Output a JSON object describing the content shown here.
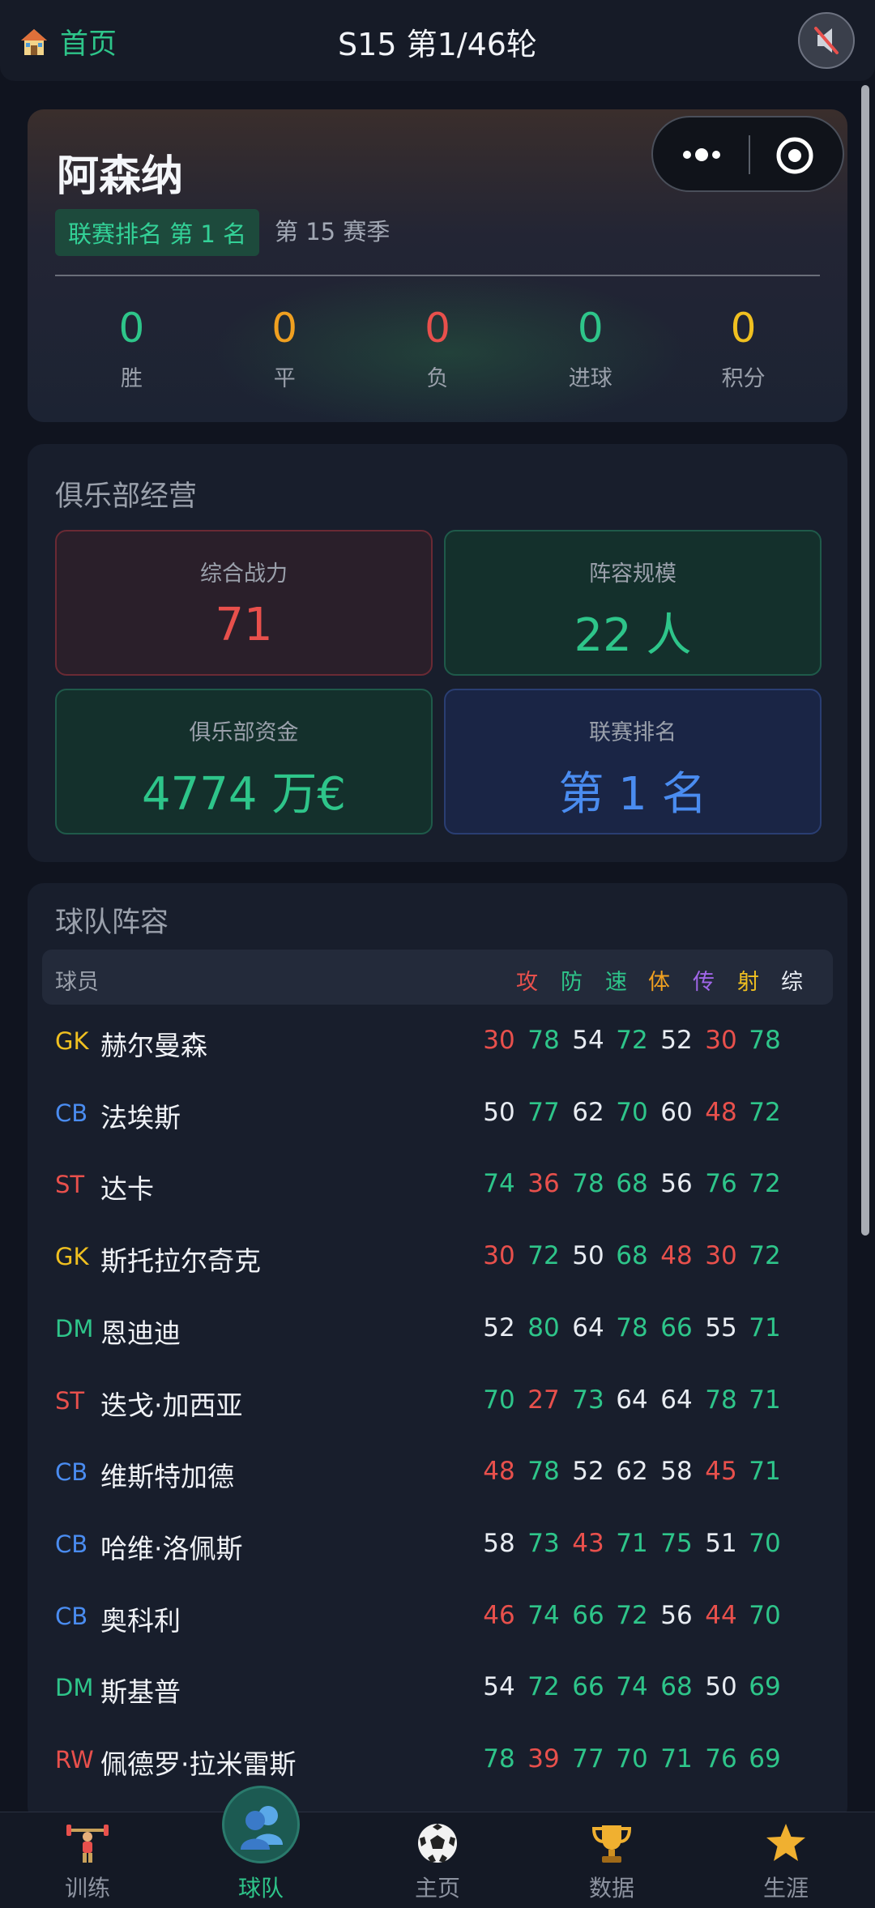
{
  "header": {
    "home_label": "首页",
    "title": "S15 第1/46轮"
  },
  "hero": {
    "team_name": "阿森纳",
    "rank_badge": "联赛排名 第 1 名",
    "season": "第 15 赛季",
    "stats": [
      {
        "label": "胜",
        "value": "0",
        "color": "#2ec58a"
      },
      {
        "label": "平",
        "value": "0",
        "color": "#f0a020"
      },
      {
        "label": "负",
        "value": "0",
        "color": "#e8504c"
      },
      {
        "label": "进球",
        "value": "0",
        "color": "#2ec58a"
      },
      {
        "label": "积分",
        "value": "0",
        "color": "#f0c020"
      }
    ]
  },
  "club": {
    "title": "俱乐部经营",
    "tiles": [
      {
        "label": "综合战力",
        "value": "71"
      },
      {
        "label": "阵容规模",
        "value": "22 人"
      },
      {
        "label": "俱乐部资金",
        "value": "4774 万€"
      },
      {
        "label": "联赛排名",
        "value": "第 1 名"
      }
    ]
  },
  "roster": {
    "title": "球队阵容",
    "headers": {
      "player": "球员",
      "cols": [
        "攻",
        "防",
        "速",
        "体",
        "传",
        "射",
        "综"
      ]
    },
    "header_colors": [
      "#e8504c",
      "#2ec58a",
      "#2ec58a",
      "#f0a020",
      "#a066e8",
      "#f0c020",
      "#e8ecf2"
    ],
    "rows": [
      {
        "pos": "GK",
        "name": "赫尔曼森",
        "vals": [
          "30",
          "78",
          "54",
          "72",
          "52",
          "30",
          "78"
        ]
      },
      {
        "pos": "CB",
        "name": "法埃斯",
        "vals": [
          "50",
          "77",
          "62",
          "70",
          "60",
          "48",
          "72"
        ]
      },
      {
        "pos": "ST",
        "name": "达卡",
        "vals": [
          "74",
          "36",
          "78",
          "68",
          "56",
          "76",
          "72"
        ]
      },
      {
        "pos": "GK",
        "name": "斯托拉尔奇克",
        "vals": [
          "30",
          "72",
          "50",
          "68",
          "48",
          "30",
          "72"
        ]
      },
      {
        "pos": "DM",
        "name": "恩迪迪",
        "vals": [
          "52",
          "80",
          "64",
          "78",
          "66",
          "55",
          "71"
        ]
      },
      {
        "pos": "ST",
        "name": "迭戈·加西亚",
        "vals": [
          "70",
          "27",
          "73",
          "64",
          "64",
          "78",
          "71"
        ]
      },
      {
        "pos": "CB",
        "name": "维斯特加德",
        "vals": [
          "48",
          "78",
          "52",
          "62",
          "58",
          "45",
          "71"
        ]
      },
      {
        "pos": "CB",
        "name": "哈维·洛佩斯",
        "vals": [
          "58",
          "73",
          "43",
          "71",
          "75",
          "51",
          "70"
        ]
      },
      {
        "pos": "CB",
        "name": "奥科利",
        "vals": [
          "46",
          "74",
          "66",
          "72",
          "56",
          "44",
          "70"
        ]
      },
      {
        "pos": "DM",
        "name": "斯基普",
        "vals": [
          "54",
          "72",
          "66",
          "74",
          "68",
          "50",
          "69"
        ]
      },
      {
        "pos": "RW",
        "name": "佩德罗·拉米雷斯",
        "vals": [
          "78",
          "39",
          "77",
          "70",
          "71",
          "76",
          "69"
        ]
      }
    ],
    "val_colors": [
      [
        "#e8504c",
        "#2ec58a",
        "#e8ecf2",
        "#2ec58a",
        "#e8ecf2",
        "#e8504c",
        "#2ec58a"
      ],
      [
        "#e8ecf2",
        "#2ec58a",
        "#e8ecf2",
        "#2ec58a",
        "#e8ecf2",
        "#e8504c",
        "#2ec58a"
      ],
      [
        "#2ec58a",
        "#e8504c",
        "#2ec58a",
        "#2ec58a",
        "#e8ecf2",
        "#2ec58a",
        "#2ec58a"
      ],
      [
        "#e8504c",
        "#2ec58a",
        "#e8ecf2",
        "#2ec58a",
        "#e8504c",
        "#e8504c",
        "#2ec58a"
      ],
      [
        "#e8ecf2",
        "#2ec58a",
        "#e8ecf2",
        "#2ec58a",
        "#2ec58a",
        "#e8ecf2",
        "#2ec58a"
      ],
      [
        "#2ec58a",
        "#e8504c",
        "#2ec58a",
        "#e8ecf2",
        "#e8ecf2",
        "#2ec58a",
        "#2ec58a"
      ],
      [
        "#e8504c",
        "#2ec58a",
        "#e8ecf2",
        "#e8ecf2",
        "#e8ecf2",
        "#e8504c",
        "#2ec58a"
      ],
      [
        "#e8ecf2",
        "#2ec58a",
        "#e8504c",
        "#2ec58a",
        "#2ec58a",
        "#e8ecf2",
        "#2ec58a"
      ],
      [
        "#e8504c",
        "#2ec58a",
        "#2ec58a",
        "#2ec58a",
        "#e8ecf2",
        "#e8504c",
        "#2ec58a"
      ],
      [
        "#e8ecf2",
        "#2ec58a",
        "#2ec58a",
        "#2ec58a",
        "#2ec58a",
        "#e8ecf2",
        "#2ec58a"
      ],
      [
        "#2ec58a",
        "#e8504c",
        "#2ec58a",
        "#2ec58a",
        "#2ec58a",
        "#2ec58a",
        "#2ec58a"
      ]
    ],
    "pos_colors": {
      "GK": "#f0c020",
      "CB": "#4a8cf0",
      "ST": "#e8504c",
      "DM": "#2ec58a",
      "RW": "#e8504c"
    }
  },
  "nav": [
    {
      "label": "训练",
      "icon": "weightlifter-icon"
    },
    {
      "label": "球队",
      "icon": "team-icon"
    },
    {
      "label": "主页",
      "icon": "soccer-ball-icon"
    },
    {
      "label": "数据",
      "icon": "trophy-icon"
    },
    {
      "label": "生涯",
      "icon": "star-icon"
    }
  ],
  "nav_active_color": "#2ec58a"
}
